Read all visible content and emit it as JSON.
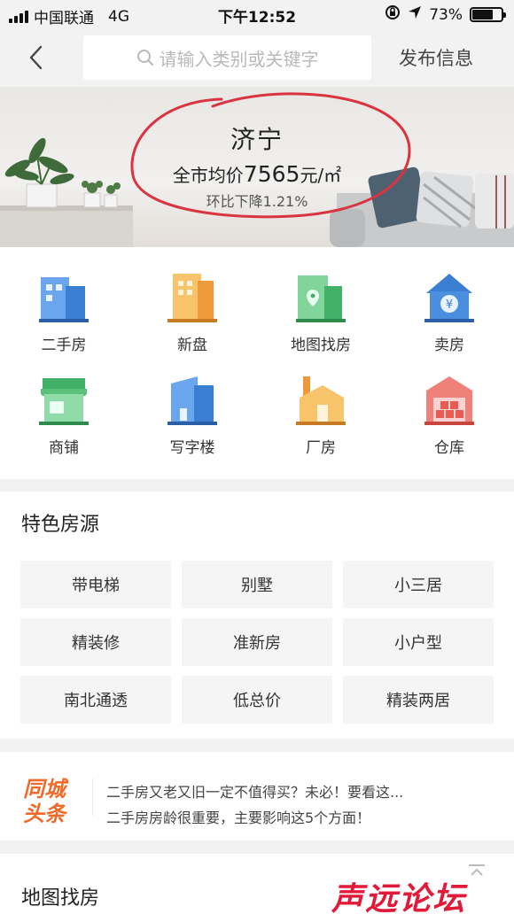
{
  "status_bar": {
    "carrier": "中国联通",
    "network": "4G",
    "time": "下午12:52",
    "battery": "73%",
    "battery_level": 0.73
  },
  "nav": {
    "search_placeholder": "请输入类别或关键字",
    "publish_label": "发布信息"
  },
  "banner": {
    "city": "济宁",
    "avg_label": "全市均价",
    "avg_value": "7565",
    "avg_unit": "元/㎡",
    "change": "环比下降1.21%"
  },
  "categories": [
    {
      "label": "二手房",
      "icon": "building-icon"
    },
    {
      "label": "新盘",
      "icon": "new-building-icon"
    },
    {
      "label": "地图找房",
      "icon": "map-building-icon"
    },
    {
      "label": "卖房",
      "icon": "sell-house-icon"
    },
    {
      "label": "商铺",
      "icon": "shop-icon"
    },
    {
      "label": "写字楼",
      "icon": "office-icon"
    },
    {
      "label": "厂房",
      "icon": "factory-icon"
    },
    {
      "label": "仓库",
      "icon": "warehouse-icon"
    }
  ],
  "featured": {
    "title": "特色房源",
    "tags": [
      "带电梯",
      "别墅",
      "小三居",
      "精装修",
      "准新房",
      "小户型",
      "南北通透",
      "低总价",
      "精装两居"
    ]
  },
  "news": {
    "logo_line1": "同城",
    "logo_line2": "头条",
    "headlines": [
      "二手房又老又旧一定不值得买？未必！要看这...",
      "二手房房龄很重要，主要影响这5个方面！"
    ]
  },
  "map_section": {
    "title": "地图找房"
  },
  "watermark": "声远论坛",
  "colors": {
    "accent_red": "#e21a3a",
    "icon_blue": "#4a90e2",
    "icon_orange": "#f0a94a",
    "icon_green": "#5cc07a",
    "logo_orange": "#f06a2a"
  }
}
